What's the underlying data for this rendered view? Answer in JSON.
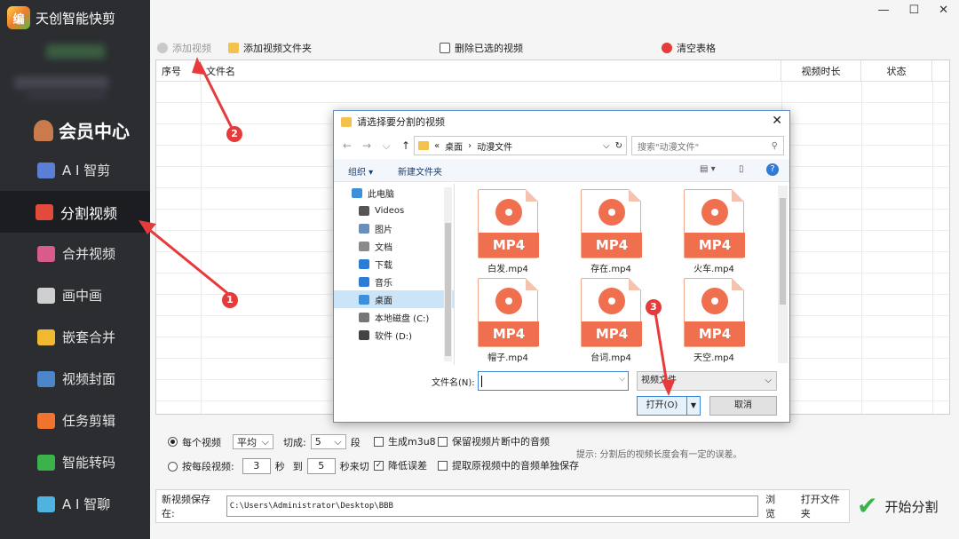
{
  "app": {
    "title": "天创智能快剪",
    "logo_text": "编"
  },
  "window": {
    "minimize": "—",
    "maximize": "☐",
    "close": "✕"
  },
  "sidebar": {
    "vip": "会员中心",
    "items": [
      {
        "label": "A I 智剪",
        "icon": "ai-edit-icon",
        "color": "#5b7fd6"
      },
      {
        "label": "分割视频",
        "icon": "split-video-icon",
        "color": "#e24a3b"
      },
      {
        "label": "合并视频",
        "icon": "merge-video-icon",
        "color": "#d85b8c"
      },
      {
        "label": "画中画",
        "icon": "picture-in-picture-icon",
        "color": "#cfcfcf"
      },
      {
        "label": "嵌套合并",
        "icon": "nested-merge-icon",
        "color": "#f0b92f"
      },
      {
        "label": "视频封面",
        "icon": "cover-icon",
        "color": "#4a86c8"
      },
      {
        "label": "任务剪辑",
        "icon": "task-edit-icon",
        "color": "#f0732e"
      },
      {
        "label": "智能转码",
        "icon": "transcode-icon",
        "color": "#3bb34a"
      },
      {
        "label": "A I 智聊",
        "icon": "ai-chat-icon",
        "color": "#4fb3e0"
      }
    ],
    "active_index": 1
  },
  "toolbar": {
    "add_video": "添加视频",
    "add_folder": "添加视频文件夹",
    "delete_selected": "删除已选的视频",
    "clear_table": "清空表格"
  },
  "table": {
    "columns": [
      "序号",
      "文件名",
      "视频时长",
      "状态"
    ]
  },
  "options": {
    "per_video_label": "每个视频",
    "mode_value": "平均",
    "split_into_label": "切成:",
    "split_count": "5",
    "segments_unit": "段",
    "per_segment_label": "按每段视频:",
    "sec_from": "3",
    "sec_unit": "秒",
    "to_label": "到",
    "sec_to": "5",
    "sec_end": "秒来切",
    "gen_m3u8": "生成m3u8",
    "reduce_error": "降低误差",
    "keep_audio": "保留视频片断中的音频",
    "extract_audio": "提取原视频中的音频单独保存",
    "hint": "提示: 分割后的视频长度会有一定的误差。"
  },
  "save": {
    "label": "新视频保存在:",
    "path": "C:\\Users\\Administrator\\Desktop\\BBB",
    "browse": "浏览",
    "open_folder": "打开文件夹"
  },
  "start": "开始分割",
  "dialog": {
    "title": "请选择要分割的视频",
    "breadcrumb": [
      "«",
      "桌面",
      "›",
      "动漫文件"
    ],
    "search_placeholder": "搜索\"动漫文件\"",
    "organize": "组织 ▾",
    "new_folder": "新建文件夹",
    "nav": [
      {
        "label": "此电脑",
        "icon": "computer-icon",
        "color": "#3d8fd9",
        "level": "root"
      },
      {
        "label": "Videos",
        "icon": "videos-folder-icon",
        "color": "#555",
        "level": "sub"
      },
      {
        "label": "图片",
        "icon": "pictures-folder-icon",
        "color": "#6a8fb8",
        "level": "sub"
      },
      {
        "label": "文档",
        "icon": "documents-folder-icon",
        "color": "#8a8a8a",
        "level": "sub"
      },
      {
        "label": "下载",
        "icon": "downloads-folder-icon",
        "color": "#2b7ed6",
        "level": "sub"
      },
      {
        "label": "音乐",
        "icon": "music-folder-icon",
        "color": "#2b7ed6",
        "level": "sub"
      },
      {
        "label": "桌面",
        "icon": "desktop-folder-icon",
        "color": "#3d8fd9",
        "level": "sub",
        "selected": true
      },
      {
        "label": "本地磁盘 (C:)",
        "icon": "drive-c-icon",
        "color": "#777",
        "level": "sub"
      },
      {
        "label": "软件 (D:)",
        "icon": "drive-d-icon",
        "color": "#444",
        "level": "sub"
      }
    ],
    "file_badge": "MP4",
    "files": [
      "白发.mp4",
      "存在.mp4",
      "火车.mp4",
      "帽子.mp4",
      "台词.mp4",
      "天空.mp4"
    ],
    "filename_label": "文件名(N):",
    "filename_value": "",
    "filetype": "视频文件",
    "open": "打开(O)",
    "cancel": "取消"
  },
  "annotations": [
    "1",
    "2",
    "3"
  ]
}
